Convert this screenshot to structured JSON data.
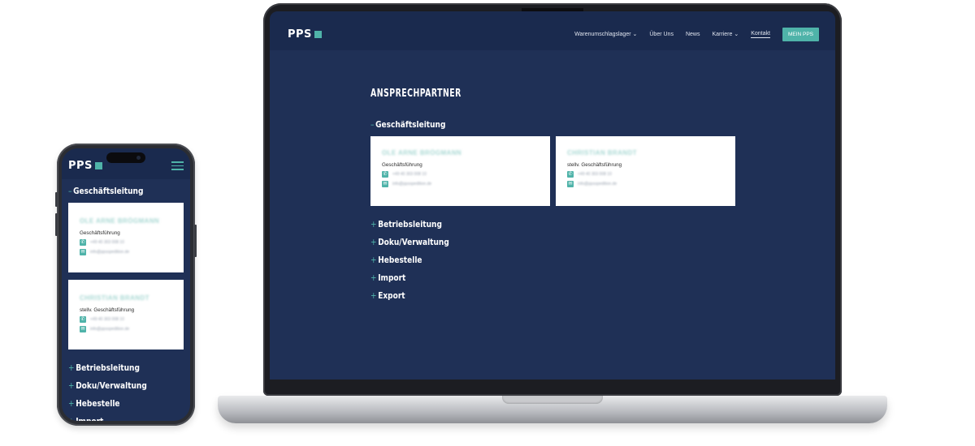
{
  "site": {
    "logo": "PPS",
    "nav": [
      {
        "label": "Warenumschlagslager",
        "dropdown": true
      },
      {
        "label": "Über Uns",
        "dropdown": false
      },
      {
        "label": "News",
        "dropdown": false
      },
      {
        "label": "Karriere",
        "dropdown": true
      },
      {
        "label": "Kontakt",
        "dropdown": false,
        "active": true
      }
    ],
    "cta": "MEIN PPS",
    "heading": "ANSPRECHPARTNER",
    "open_section": {
      "sign": "–",
      "title": "Geschäftsleitung"
    },
    "contacts": [
      {
        "name": "OLE ARNE BRÖGMANN",
        "role": "Geschäftsführung",
        "phone": "+49 40 303 008 10",
        "email": "info@ppsspedition.de"
      },
      {
        "name": "CHRISTIAN BRANDT",
        "role": "stellv. Geschäftsführung",
        "phone": "+49 40 303 008 10",
        "email": "info@ppsspedition.de"
      }
    ],
    "closed_sections": [
      {
        "sign": "+",
        "title": "Betriebsleitung"
      },
      {
        "sign": "+",
        "title": "Doku/Verwaltung"
      },
      {
        "sign": "+",
        "title": "Hebestelle"
      },
      {
        "sign": "+",
        "title": "Import"
      },
      {
        "sign": "+",
        "title": "Export"
      }
    ]
  },
  "colors": {
    "accent": "#4fb3a9",
    "background": "#1f3056",
    "header": "#1a2a4e"
  },
  "icons": {
    "phone": "phone-icon",
    "email": "mail-icon",
    "menu": "hamburger-icon",
    "dropdown": "chevron-down-icon"
  }
}
